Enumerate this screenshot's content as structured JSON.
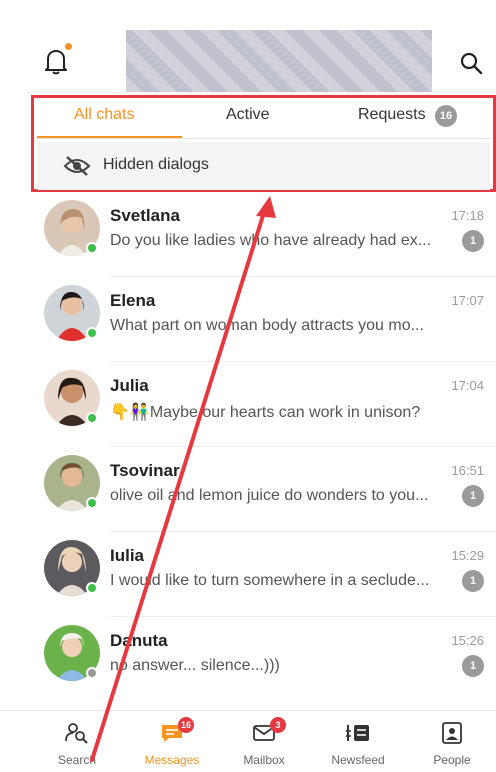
{
  "header": {
    "bell_icon": "bell-icon",
    "notification_dot_color": "#f7931e",
    "search_icon": "search-icon"
  },
  "tabs": [
    {
      "label": "All chats",
      "active": true
    },
    {
      "label": "Active",
      "active": false
    },
    {
      "label": "Requests",
      "active": false,
      "badge": "16"
    }
  ],
  "hidden_dialogs": {
    "label": "Hidden dialogs",
    "icon": "eye-off-icon"
  },
  "chats": [
    {
      "name": "Svetlana",
      "time": "17:18",
      "message": "Do you like ladies who have already had ex...",
      "count": "1",
      "online": true
    },
    {
      "name": "Elena",
      "time": "17:07",
      "message": "What part on woman body attracts you mo...",
      "count": "",
      "online": true
    },
    {
      "name": "Julia",
      "time": "17:04",
      "message": "👇👫Maybe our hearts can work in unison?",
      "count": "",
      "online": true
    },
    {
      "name": "Tsovinar",
      "time": "16:51",
      "message": "olive oil and lemon juice do wonders to you...",
      "count": "1",
      "online": true
    },
    {
      "name": "Iulia",
      "time": "15:29",
      "message": "I would like to turn somewhere in a seclude...",
      "count": "1",
      "online": true
    },
    {
      "name": "Danuta",
      "time": "15:26",
      "message": "no answer... silence...)))",
      "count": "1",
      "online": false
    }
  ],
  "nav": [
    {
      "label": "Search",
      "icon": "search-people-icon",
      "badge": "",
      "active": false
    },
    {
      "label": "Messages",
      "icon": "messages-icon",
      "badge": "16",
      "active": true
    },
    {
      "label": "Mailbox",
      "icon": "mailbox-icon",
      "badge": "3",
      "active": false
    },
    {
      "label": "Newsfeed",
      "icon": "newsfeed-icon",
      "badge": "",
      "active": false
    },
    {
      "label": "People",
      "icon": "people-icon",
      "badge": "",
      "active": false
    }
  ],
  "colors": {
    "accent": "#f7931e",
    "highlight": "#e5393f",
    "online": "#3cc04a",
    "offline": "#9a9a9a"
  }
}
